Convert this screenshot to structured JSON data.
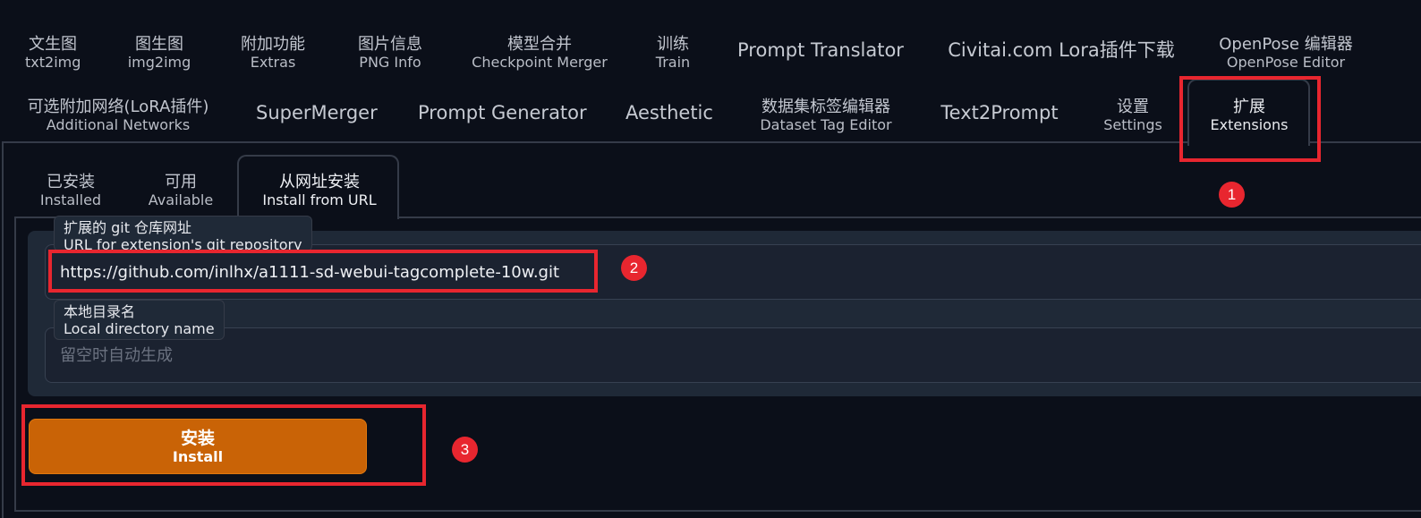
{
  "main_tabs_row1": [
    {
      "cn": "文生图",
      "en": "txt2img"
    },
    {
      "cn": "图生图",
      "en": "img2img"
    },
    {
      "cn": "附加功能",
      "en": "Extras"
    },
    {
      "cn": "图片信息",
      "en": "PNG Info"
    },
    {
      "cn": "模型合并",
      "en": "Checkpoint Merger"
    },
    {
      "cn": "训练",
      "en": "Train"
    },
    {
      "cn": "Prompt Translator"
    },
    {
      "cn": "Civitai.com Lora插件下载"
    },
    {
      "cn": "OpenPose 编辑器",
      "en": "OpenPose Editor"
    }
  ],
  "main_tabs_row2": [
    {
      "cn": "可选附加网络(LoRA插件)",
      "en": "Additional Networks"
    },
    {
      "cn": "SuperMerger"
    },
    {
      "cn": "Prompt Generator"
    },
    {
      "cn": "Aesthetic"
    },
    {
      "cn": "数据集标签编辑器",
      "en": "Dataset Tag Editor"
    },
    {
      "cn": "Text2Prompt"
    },
    {
      "cn": "设置",
      "en": "Settings"
    },
    {
      "cn": "扩展",
      "en": "Extensions"
    }
  ],
  "sub_tabs": [
    {
      "cn": "已安装",
      "en": "Installed"
    },
    {
      "cn": "可用",
      "en": "Available"
    },
    {
      "cn": "从网址安装",
      "en": "Install from URL"
    }
  ],
  "url_field": {
    "label_cn": "扩展的 git 仓库网址",
    "label_en": "URL for extension's git repository",
    "value": "https://github.com/inlhx/a1111-sd-webui-tagcomplete-10w.git"
  },
  "dir_field": {
    "label_cn": "本地目录名",
    "label_en": "Local directory name",
    "placeholder": "留空时自动生成"
  },
  "install_button": {
    "cn": "安装",
    "en": "Install"
  },
  "annotations": [
    "1",
    "2",
    "3"
  ],
  "colors": {
    "background": "#0b0f19",
    "button": "#c96306",
    "highlight": "#e8262f"
  }
}
